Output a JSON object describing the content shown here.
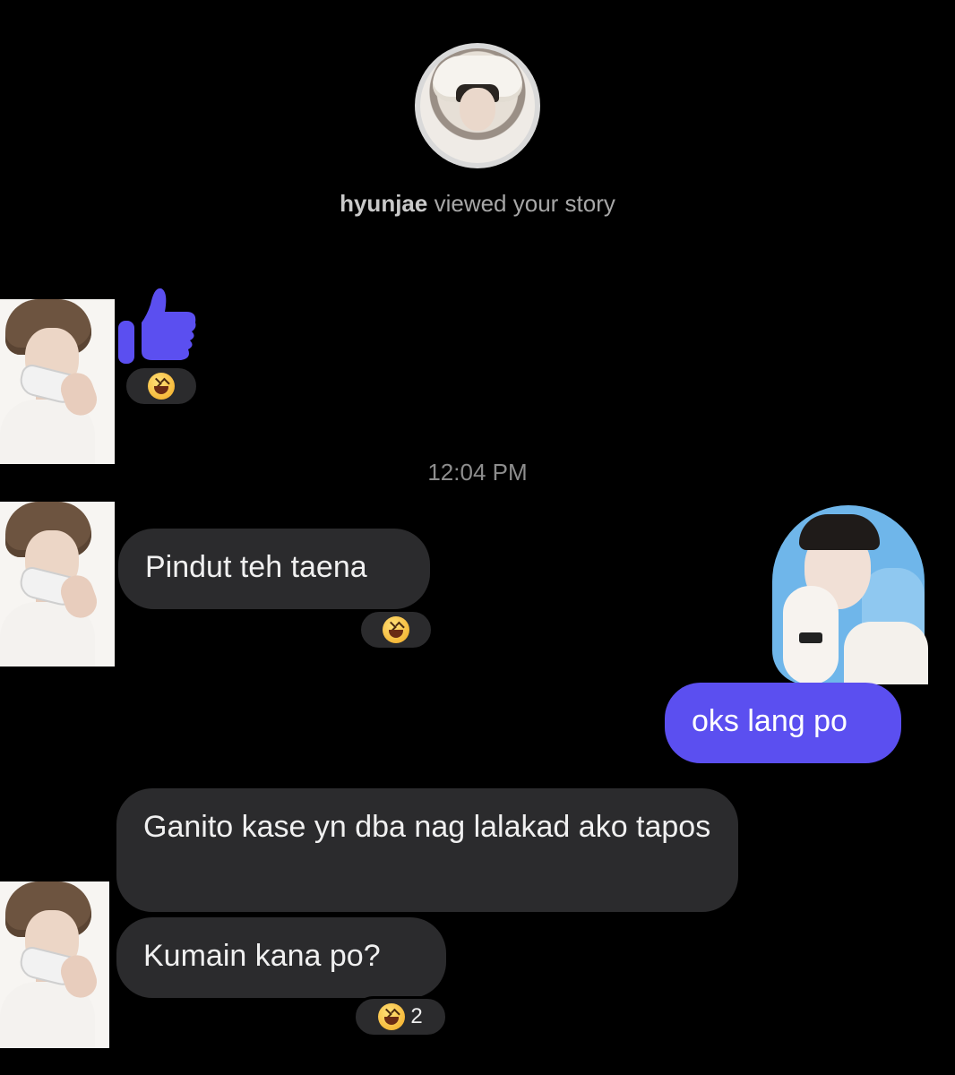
{
  "story": {
    "viewer_name": "hyunjae",
    "viewed_text": "viewed your story"
  },
  "timestamp": "12:04 PM",
  "messages": [
    {
      "type": "like",
      "from": "them",
      "reaction": {
        "emoji": "laughing-face",
        "count": ""
      }
    },
    {
      "type": "text",
      "from": "them",
      "text": "Pindut teh taena",
      "reaction": {
        "emoji": "laughing-face",
        "count": ""
      }
    },
    {
      "type": "text",
      "from": "me",
      "text": "oks lang po"
    },
    {
      "type": "text",
      "from": "them",
      "text": "Ganito kase yn dba nag lalakad ako tapos"
    },
    {
      "type": "text",
      "from": "them",
      "text": "Kumain kana po?",
      "reaction": {
        "emoji": "laughing-face",
        "count": "2"
      }
    }
  ],
  "colors": {
    "background": "#000000",
    "incoming_bubble": "#2b2b2d",
    "outgoing_bubble": "#5b4ff0",
    "like_icon": "#5b4ff0",
    "secondary_text": "#8d8d8d"
  }
}
